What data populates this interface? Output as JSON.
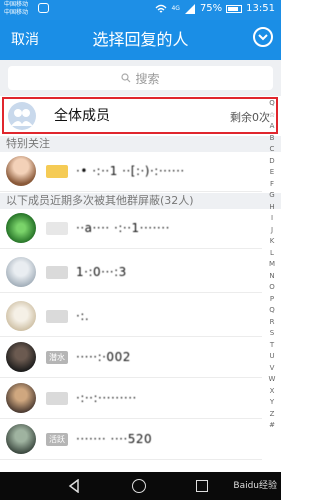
{
  "status_bar": {
    "carrier1": "中国移动",
    "carrier2": "中国移动",
    "network": "4G",
    "battery": "75%",
    "time": "13:51"
  },
  "header": {
    "cancel_label": "取消",
    "title": "选择回复的人"
  },
  "search": {
    "placeholder": "搜索"
  },
  "all_members": {
    "label": "全体成员",
    "remaining": "剩余0次"
  },
  "sections": {
    "special": "特别关注",
    "frequent": "以下成员近期多次被其他群屏蔽(32人)"
  },
  "members": [
    {
      "badge": "",
      "name": "·• ·:··1 ··[:·)·:······"
    },
    {
      "badge": "",
      "name": "··a···· ·:··1·······"
    },
    {
      "badge": "",
      "name": "1·:0···:3"
    },
    {
      "badge": "",
      "name": "·:."
    },
    {
      "badge": "潜水",
      "name": "·····:·002"
    },
    {
      "badge": "",
      "name": "·:··:·········"
    },
    {
      "badge": "活跃",
      "name": "······· ····520"
    }
  ],
  "index_letters": [
    "Q",
    "☆",
    "A",
    "B",
    "C",
    "D",
    "E",
    "F",
    "G",
    "H",
    "I",
    "J",
    "K",
    "L",
    "M",
    "N",
    "O",
    "P",
    "Q",
    "R",
    "S",
    "T",
    "U",
    "V",
    "W",
    "X",
    "Y",
    "Z",
    "#"
  ],
  "watermark": "Baidu经验",
  "colors": {
    "accent": "#1a8ee6",
    "highlight": "#e0262d"
  }
}
